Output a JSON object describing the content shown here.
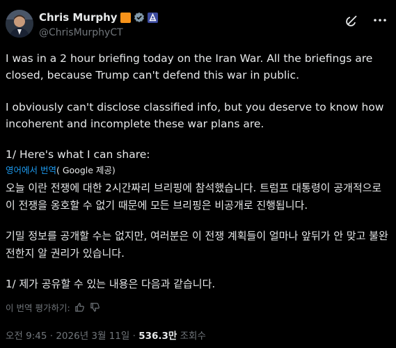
{
  "author": {
    "name": "Chris Murphy",
    "handle": "@ChrisMurphyCT",
    "avatar": "person-avatar"
  },
  "icons": {
    "orange_badge": "orange-square-badge",
    "verified": "gray-verified-check",
    "affiliation": "blue-affiliation-badge",
    "grok": "grok-icon",
    "more": "more-dots-icon"
  },
  "colors": {
    "accent": "#1d9bf0",
    "orange_badge": "#f7931a",
    "muted": "#71767b"
  },
  "post": {
    "p1": "I was in a 2 hour briefing today on the Iran War. All the briefings are closed, because Trump can't defend this war in public.",
    "p2": "I obviously can't disclose classified info, but you deserve to know how incoherent and incomplete these war plans are.",
    "p3": "1/ Here's what I can share:"
  },
  "translation": {
    "link_label": "영어에서 번역",
    "provider": "( Google 제공)",
    "k1": "오늘 이란 전쟁에 대한 2시간짜리 브리핑에 참석했습니다. 트럼프 대통령이 공개적으로 이 전쟁을 옹호할 수 없기 때문에 모든 브리핑은 비공개로 진행됩니다.",
    "k2": "기밀 정보를 공개할 수는 없지만, 여러분은 이 전쟁 계획들이 얼마나 앞뒤가 안 맞고 불완전한지 알 권리가 있습니다.",
    "k3": "1/ 제가 공유할 수 있는 내용은 다음과 같습니다.",
    "rate_label": "이 번역 평가하기:"
  },
  "meta": {
    "time": "오전 9:45",
    "dot": "·",
    "date": "2026년 3월 11일",
    "views_count": "536.3만",
    "views_label": "조회수"
  }
}
